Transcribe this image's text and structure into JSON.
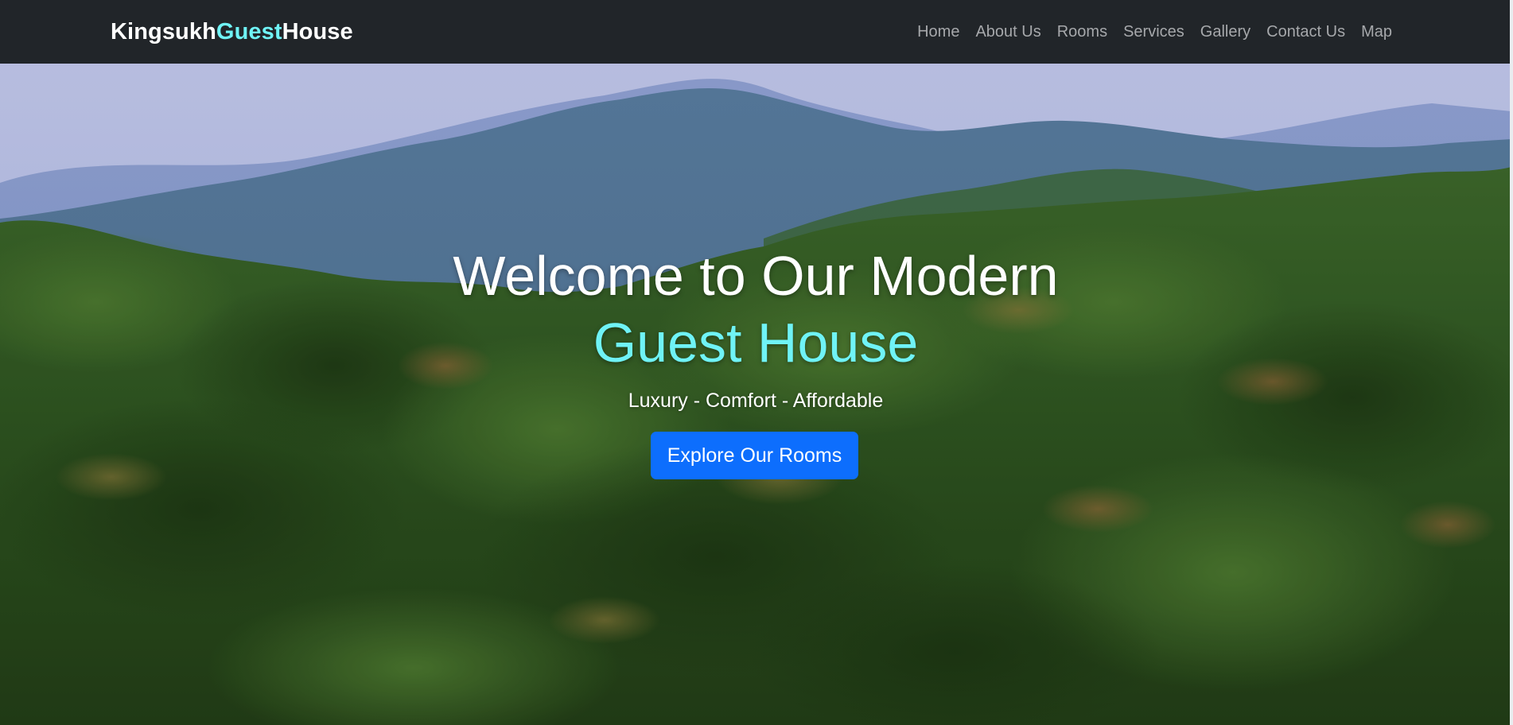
{
  "navbar": {
    "brand": {
      "part1": "Kingsukh ",
      "accent": "Guest",
      "part3": " House"
    },
    "links": [
      "Home",
      "About Us",
      "Rooms",
      "Services",
      "Gallery",
      "Contact Us",
      "Map"
    ]
  },
  "hero": {
    "title_line1": "Welcome to Our Modern",
    "title_line2": "Guest House",
    "tagline": "Luxury - Comfort - Affordable",
    "cta_label": "Explore Our Rooms",
    "background": "forested-hills-photo"
  },
  "colors": {
    "navbar_bg": "#212529",
    "accent_cyan": "#6ff3f6",
    "nav_link": "#a6a8ab",
    "button_blue": "#0d6efd"
  }
}
